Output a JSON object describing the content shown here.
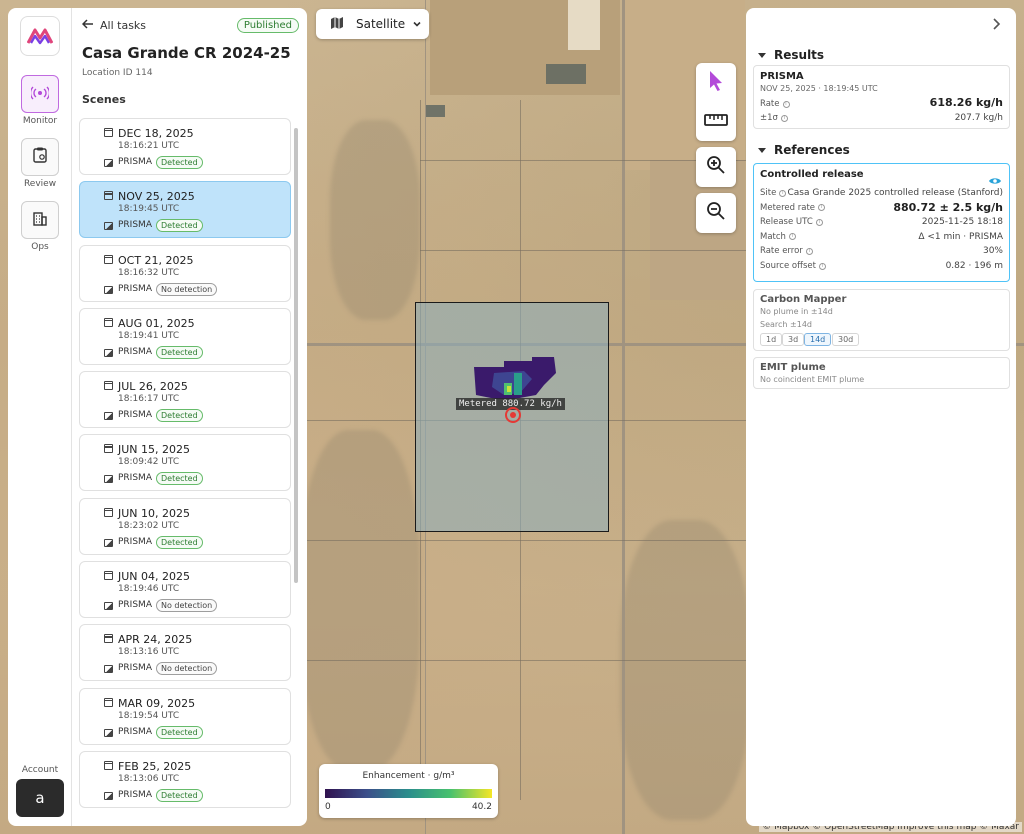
{
  "nav": {
    "items": [
      {
        "label": "Monitor",
        "icon": "broadcast-icon",
        "active": true
      },
      {
        "label": "Review",
        "icon": "clipboard-icon",
        "active": false
      },
      {
        "label": "Ops",
        "icon": "building-icon",
        "active": false
      }
    ],
    "account_label": "Account",
    "account_initial": "a"
  },
  "task": {
    "back_label": "All tasks",
    "status": "Published",
    "title": "Casa Grande CR 2024-25",
    "location": "Location ID 114",
    "scenes_heading": "Scenes"
  },
  "scenes": [
    {
      "date": "DEC 18, 2025",
      "time": "18:16:21 UTC",
      "sensor": "PRISMA",
      "status": "Detected",
      "selected": false
    },
    {
      "date": "NOV 25, 2025",
      "time": "18:19:45 UTC",
      "sensor": "PRISMA",
      "status": "Detected",
      "selected": true
    },
    {
      "date": "OCT 21, 2025",
      "time": "18:16:32 UTC",
      "sensor": "PRISMA",
      "status": "No detection",
      "selected": false
    },
    {
      "date": "AUG 01, 2025",
      "time": "18:19:41 UTC",
      "sensor": "PRISMA",
      "status": "Detected",
      "selected": false
    },
    {
      "date": "JUL 26, 2025",
      "time": "18:16:17 UTC",
      "sensor": "PRISMA",
      "status": "Detected",
      "selected": false
    },
    {
      "date": "JUN 15, 2025",
      "time": "18:09:42 UTC",
      "sensor": "PRISMA",
      "status": "Detected",
      "selected": false
    },
    {
      "date": "JUN 10, 2025",
      "time": "18:23:02 UTC",
      "sensor": "PRISMA",
      "status": "Detected",
      "selected": false
    },
    {
      "date": "JUN 04, 2025",
      "time": "18:19:46 UTC",
      "sensor": "PRISMA",
      "status": "No detection",
      "selected": false
    },
    {
      "date": "APR 24, 2025",
      "time": "18:13:16 UTC",
      "sensor": "PRISMA",
      "status": "No detection",
      "selected": false
    },
    {
      "date": "MAR 09, 2025",
      "time": "18:19:54 UTC",
      "sensor": "PRISMA",
      "status": "Detected",
      "selected": false
    },
    {
      "date": "FEB 25, 2025",
      "time": "18:13:06 UTC",
      "sensor": "PRISMA",
      "status": "Detected",
      "selected": false
    }
  ],
  "map": {
    "layer": "Satellite",
    "plume_label": "Metered  880.72 kg/h",
    "legend": {
      "title": "Enhancement · g/m³",
      "min": "0",
      "max": "40.2"
    },
    "attribution": "© Mapbox © OpenStreetMap Improve this map © Maxar",
    "tools": [
      "select-icon",
      "ruler-icon",
      "zoom-in-icon",
      "zoom-out-icon"
    ]
  },
  "results": {
    "heading": "Results",
    "sensor": "PRISMA",
    "timestamp": "NOV 25, 2025 · 18:19:45 UTC",
    "rate_label": "Rate",
    "rate_value": "618.26 kg/h",
    "sigma_label": "±1σ",
    "sigma_value": "207.7 kg/h"
  },
  "references": {
    "heading": "References",
    "controlled": {
      "title": "Controlled release",
      "rows": [
        {
          "label": "Site",
          "value": "Casa Grande 2025 controlled release (Stanford)"
        },
        {
          "label": "Metered rate",
          "value": "880.72 ± 2.5 kg/h",
          "big": true
        },
        {
          "label": "Release UTC",
          "value": "2025-11-25 18:18"
        },
        {
          "label": "Match",
          "value": "Δ <1 min · PRISMA"
        },
        {
          "label": "Rate error",
          "value": "30%"
        },
        {
          "label": "Source offset",
          "value": "0.82 · 196 m"
        }
      ]
    },
    "carbon_mapper": {
      "title": "Carbon Mapper",
      "note": "No plume in ±14d",
      "search_label": "Search ±14d",
      "chips": [
        "1d",
        "3d",
        "14d",
        "30d"
      ],
      "active_chip": "14d"
    },
    "emit": {
      "title": "EMIT plume",
      "note": "No coincident EMIT plume"
    }
  },
  "colors": {
    "accent": "#c06ae0",
    "selected": "#bfe3fa",
    "detected": "#2e7d32",
    "highlight": "#4fc3f7"
  }
}
